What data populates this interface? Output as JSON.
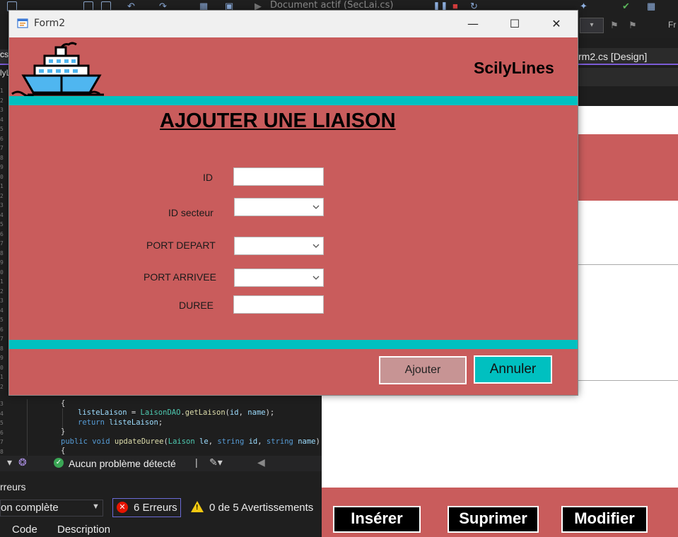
{
  "ide": {
    "document_label": "Document actif (SecLai.cs)",
    "right_tab": "rm2.cs [Design]",
    "right_locale": "Fr",
    "left_tab": "cs",
    "left_tab2": "lyLi",
    "code_lines": [
      "{",
      "listeLaison = LaisonDAO.getLaison(id, name);",
      "return listeLaison;",
      "}",
      "public void updateDuree(Laison le, string id, string name)",
      "{"
    ],
    "status": "Aucun problème détecté",
    "error_panel_title": "rreurs",
    "filter_value": "on complète",
    "errors_label": "6 Erreurs",
    "warnings_label": "0 de 5 Avertissements",
    "columns": {
      "code": "Code",
      "description": "Description"
    },
    "bottom_buttons": {
      "inserer": "Insérer",
      "suprimer": "Suprimer",
      "modifier": "Modifier"
    }
  },
  "window": {
    "title": "Form2",
    "brand": "ScilyLines",
    "heading": "AJOUTER UNE LIAISON",
    "fields": {
      "id": {
        "label": "ID",
        "value": ""
      },
      "id_secteur": {
        "label": "ID secteur",
        "value": ""
      },
      "port_depart": {
        "label": "PORT DEPART",
        "value": ""
      },
      "port_arrivee": {
        "label": "PORT ARRIVEE",
        "value": ""
      },
      "duree": {
        "label": "DUREE",
        "value": ""
      }
    },
    "buttons": {
      "ajouter": "Ajouter",
      "annuler": "Annuler"
    }
  },
  "colors": {
    "form_background": "#c95c5c",
    "accent_teal": "#00c0c0",
    "ide_background": "#1e1e1e"
  }
}
